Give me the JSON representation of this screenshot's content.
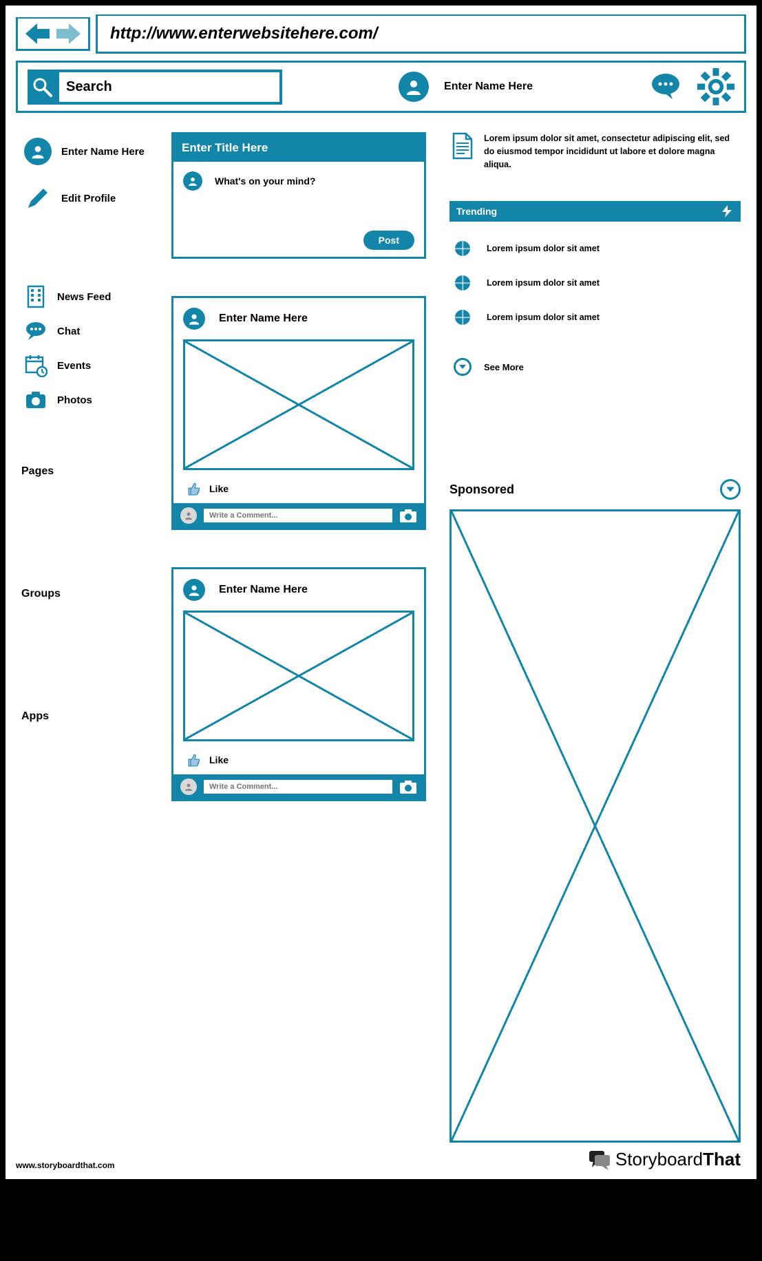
{
  "url": "http://www.enterwebsitehere.com/",
  "topbar": {
    "search_placeholder": "Search",
    "profile_name": "Enter Name Here"
  },
  "sidebar": {
    "profile_name": "Enter Name Here",
    "edit_profile": "Edit Profile",
    "items": [
      {
        "label": "News Feed"
      },
      {
        "label": "Chat"
      },
      {
        "label": "Events"
      },
      {
        "label": "Photos"
      }
    ],
    "sections": [
      "Pages",
      "Groups",
      "Apps"
    ]
  },
  "compose": {
    "title": "Enter Title Here",
    "prompt": "What's on your mind?",
    "post_button": "Post"
  },
  "posts": [
    {
      "author": "Enter Name Here",
      "like_label": "Like",
      "comment_placeholder": "Write a Comment..."
    },
    {
      "author": "Enter Name Here",
      "like_label": "Like",
      "comment_placeholder": "Write a Comment..."
    }
  ],
  "right": {
    "info_text": "Lorem ipsum dolor sit amet, consectetur adipiscing elit, sed do eiusmod tempor incididunt ut labore et dolore magna aliqua.",
    "trending_title": "Trending",
    "trending_items": [
      "Lorem ipsum dolor sit amet",
      "Lorem ipsum dolor sit amet",
      "Lorem ipsum dolor sit amet"
    ],
    "see_more": "See More",
    "sponsored_title": "Sponsored"
  },
  "footer": {
    "url": "www.storyboardthat.com",
    "brand_1": "Storyboard",
    "brand_2": "That"
  }
}
